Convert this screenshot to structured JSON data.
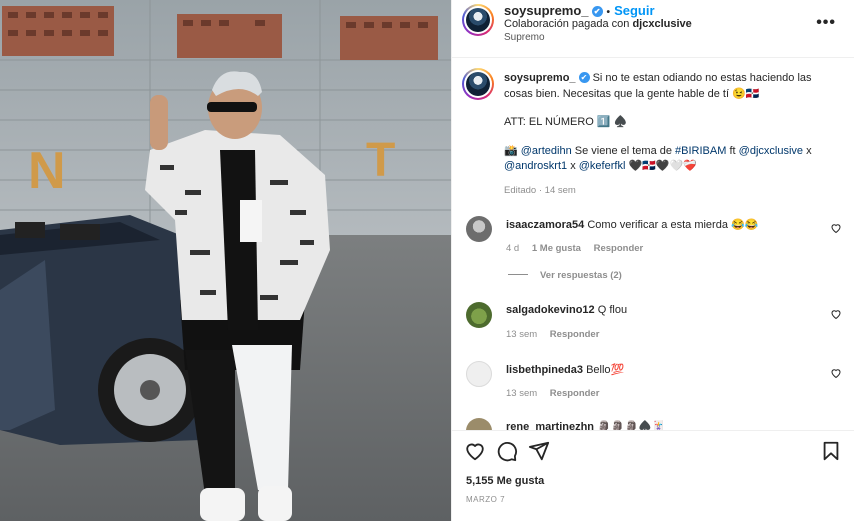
{
  "header": {
    "username": "soysupremo_",
    "verified_mark": "✔",
    "separator": "•",
    "follow_label": "Seguir",
    "collab_prefix": "Colaboración pagada con",
    "collab_user": "djcxclusive",
    "location": "Supremo",
    "more_label": "•••"
  },
  "caption": {
    "username": "soysupremo_",
    "line1": "Si no te estan odiando no estas haciendo las cosas bien. Necesitas que la gente hable de tí 😉🇩🇴",
    "line2": "ATT: EL NÚMERO 1️⃣ ♠️",
    "credit_prefix": "📸",
    "credit_user1": "@artedihn",
    "credit_text": "Se viene el tema de",
    "hashtag": "#BIRIBAM",
    "ft": "ft",
    "credit_user2": "@djcxclusive",
    "x1": "x",
    "credit_user3": "@androskrt1",
    "x2": "x",
    "credit_user4": "@keferfkl",
    "hearts": "🖤🇩🇴🖤🤍❤️‍🩹",
    "edited": "Editado · 14 sem"
  },
  "comments": [
    {
      "user": "isaaczamora54",
      "text": "Como verificar a esta mierda 😂😂",
      "time": "4 d",
      "likes": "1 Me gusta",
      "reply": "Responder"
    },
    {
      "user": "salgadokevino12",
      "text": "Q flou",
      "time": "13 sem",
      "reply": "Responder"
    },
    {
      "user": "lisbethpineda3",
      "text": "Bello💯",
      "time": "13 sem",
      "reply": "Responder"
    },
    {
      "user": "rene_martinezhn",
      "text": "🗿🗿🗿♠️🃏"
    }
  ],
  "view_replies": "Ver respuestas (2)",
  "footer": {
    "likes": "5,155 Me gusta",
    "date": "MARZO 7"
  },
  "photo": {
    "wall_letter_left": "N",
    "wall_letter_right": "T"
  },
  "colors": {
    "follow": "#0095f6",
    "link": "#00376b",
    "muted": "#8e8e8e"
  }
}
